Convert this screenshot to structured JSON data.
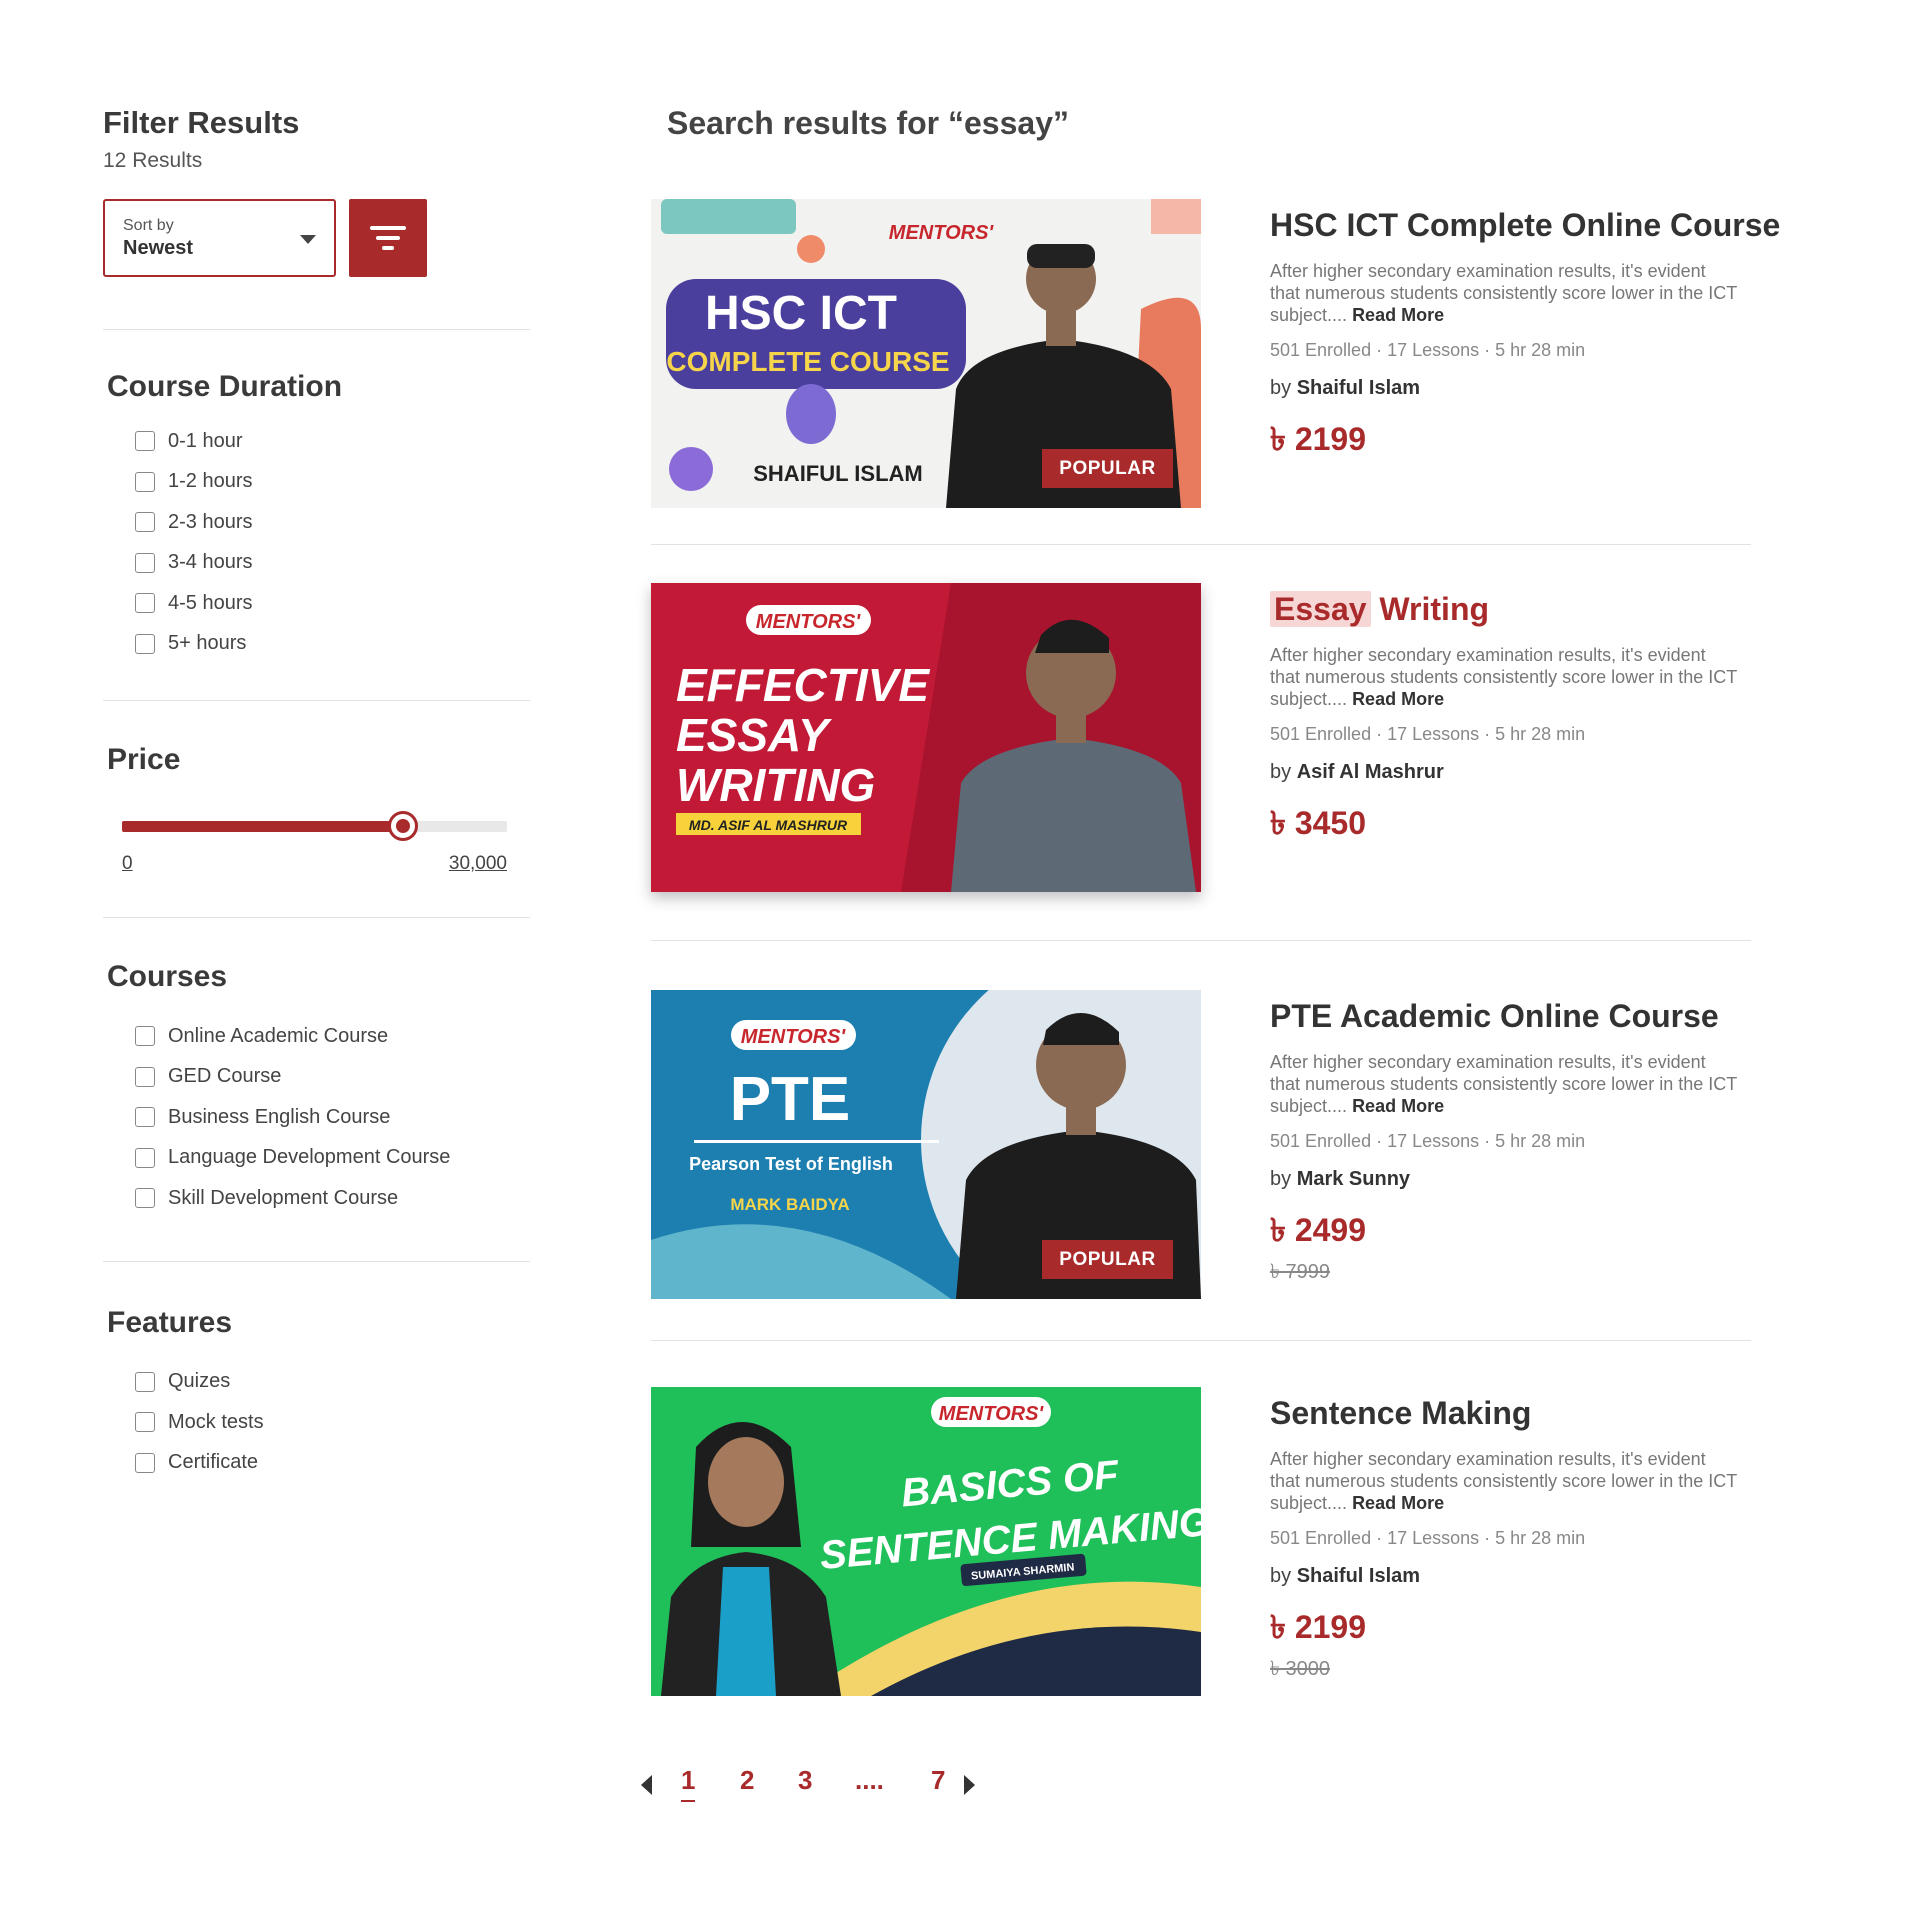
{
  "sidebar": {
    "title": "Filter Results",
    "result_count": "12 Results",
    "sort": {
      "label": "Sort by",
      "value": "Newest"
    },
    "duration": {
      "title": "Course Duration",
      "options": [
        "0-1 hour",
        "1-2 hours",
        "2-3 hours",
        "3-4 hours",
        "4-5 hours",
        "5+ hours"
      ]
    },
    "price": {
      "title": "Price",
      "min_label": "0",
      "max_label": "30,000",
      "slider_value_fraction": 0.73
    },
    "courses": {
      "title": "Courses",
      "options": [
        "Online Academic Course",
        "GED Course",
        "Business English Course",
        "Language Development Course",
        "Skill Development Course"
      ]
    },
    "features": {
      "title": "Features",
      "options": [
        "Quizes",
        "Mock tests",
        "Certificate"
      ]
    }
  },
  "main": {
    "search_title": "Search results for “essay”",
    "cards": [
      {
        "title": "HSC ICT Complete Online Course",
        "description": "After higher secondary examination results, it's evident that numerous students consistently score lower in the ICT subject....",
        "read_more": "Read More",
        "meta": "501 Enrolled · 17 Lessons · 5 hr 28 min",
        "by_prefix": "by",
        "author": "Shaiful Islam",
        "price": "৳ 2199",
        "old_price": "",
        "badge": "POPULAR",
        "thumb": {
          "brand": "MENTORS'",
          "line1": "HSC ICT",
          "line2": "COMPLETE COURSE",
          "name": "SHAIFUL ISLAM"
        }
      },
      {
        "title_highlight": "Essay",
        "title_rest": "Writing",
        "description": "After higher secondary examination results, it's evident that numerous students consistently score lower in the ICT subject....",
        "read_more": "Read More",
        "meta": "501 Enrolled · 17 Lessons · 5 hr 28 min",
        "by_prefix": "by",
        "author": "Asif Al Mashrur",
        "price": "৳ 3450",
        "old_price": "",
        "badge": "",
        "thumb": {
          "brand": "MENTORS'",
          "line1": "EFFECTIVE",
          "line2": "ESSAY",
          "line3": "WRITING",
          "name": "MD. ASIF AL MASHRUR"
        }
      },
      {
        "title": "PTE Academic Online Course",
        "description": "After higher secondary examination results, it's evident that numerous students consistently score lower in the ICT subject....",
        "read_more": "Read More",
        "meta": "501 Enrolled · 17 Lessons · 5 hr 28 min",
        "by_prefix": "by",
        "author": "Mark Sunny",
        "price": "৳ 2499",
        "old_price": "৳ 7999",
        "badge": "POPULAR",
        "thumb": {
          "brand": "MENTORS'",
          "line1": "PTE",
          "line2": "Pearson Test of English",
          "name": "MARK BAIDYA"
        }
      },
      {
        "title": "Sentence Making",
        "description": "After higher secondary examination results, it's evident that numerous students consistently score lower in the ICT subject....",
        "read_more": "Read More",
        "meta": "501 Enrolled · 17 Lessons · 5 hr 28 min",
        "by_prefix": "by",
        "author": "Shaiful Islam",
        "price": "৳ 2199",
        "old_price": "৳ 3000",
        "badge": "",
        "thumb": {
          "brand": "MENTORS'",
          "line1": "BASICS OF",
          "line2": "SENTENCE MAKING",
          "name": "SUMAIYA SHARMIN"
        }
      }
    ]
  },
  "pagination": {
    "pages": [
      "1",
      "2",
      "3",
      "....",
      "7"
    ],
    "active": "1"
  },
  "colors": {
    "accent": "#a82a2a",
    "highlight_bg": "#f7d6d6"
  }
}
